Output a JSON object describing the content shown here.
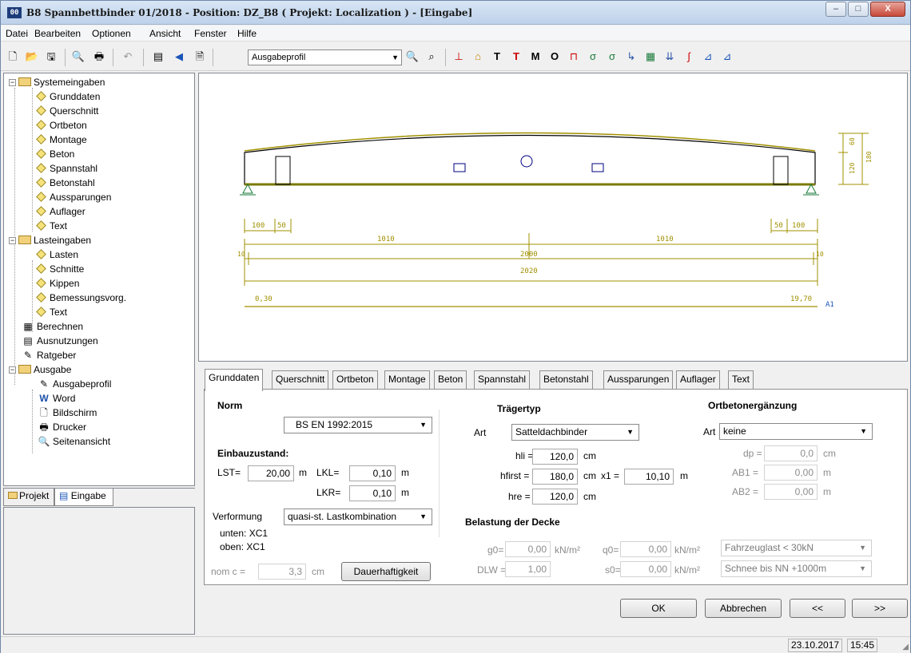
{
  "window": {
    "title": "B8 Spannbettbinder  01/2018 - Position: DZ_B8 ( Projekt: Localization ) - [Eingabe]",
    "icon_text": "00",
    "controls": {
      "minimize": "–",
      "maximize": "□",
      "close": "X"
    }
  },
  "menu": [
    "Datei",
    "Bearbeiten",
    "Optionen",
    "Ansicht",
    "Fenster",
    "Hilfe"
  ],
  "toolbar": {
    "profile_value": "Ausgabeprofil",
    "symbol_buttons": [
      "T",
      "T",
      "M",
      "O"
    ]
  },
  "tree": {
    "systemeingaben": "Systemeingaben",
    "system_items": [
      "Grunddaten",
      "Querschnitt",
      "Ortbeton",
      "Montage",
      "Beton",
      "Spannstahl",
      "Betonstahl",
      "Aussparungen",
      "Auflager",
      "Text"
    ],
    "lasteingaben": "Lasteingaben",
    "last_items": [
      "Lasten",
      "Schnitte",
      "Kippen",
      "Bemessungsvorg.",
      "Text"
    ],
    "berechnen": "Berechnen",
    "ausnutzungen": "Ausnutzungen",
    "ratgeber": "Ratgeber",
    "ausgabe": "Ausgabe",
    "ausgabe_items": [
      "Ausgabeprofil",
      "Word",
      "Bildschirm",
      "Drucker",
      "Seitenansicht"
    ]
  },
  "panel_tabs": {
    "projekt": "Projekt",
    "eingabe": "Eingabe"
  },
  "drawing": {
    "dim_left_100": "100",
    "dim_left_50": "50",
    "dim_right_50": "50",
    "dim_right_100": "100",
    "half_left": "1010",
    "half_right": "1010",
    "span_inner": "2000",
    "span_total": "2020",
    "end_left": "10",
    "end_right": "10",
    "axis_start": "0,30",
    "axis_end": "19,70",
    "axis_label": "A1",
    "height_upper": "60",
    "height_left": "120",
    "height_total": "180"
  },
  "tabs": [
    "Grunddaten",
    "Querschnitt",
    "Ortbeton",
    "Montage",
    "Beton",
    "Spannstahl",
    "Betonstahl",
    "Aussparungen",
    "Auflager",
    "Text"
  ],
  "form": {
    "norm_header": "Norm",
    "norm_value": "BS EN 1992:2015",
    "einbau_header": "Einbauzustand:",
    "lst_label": "LST=",
    "lst_value": "20,00",
    "lst_unit": "m",
    "lkl_label": "LKL=",
    "lkl_value": "0,10",
    "lkl_unit": "m",
    "lkr_label": "LKR=",
    "lkr_value": "0,10",
    "lkr_unit": "m",
    "verformung_label": "Verformung",
    "verformung_value": "quasi-st. Lastkombination",
    "unten": "unten: XC1",
    "oben": "oben: XC1",
    "nomc_label": "nom c =",
    "nomc_value": "3,3",
    "nomc_unit": "cm",
    "dauer_button": "Dauerhaftigkeit",
    "traeger_header": "Trägertyp",
    "art_label": "Art",
    "art_value": "Satteldachbinder",
    "hli_label": "hli =",
    "hli_value": "120,0",
    "hli_unit": "cm",
    "hfirst_label": "hfirst =",
    "hfirst_value": "180,0",
    "hfirst_unit": "cm",
    "x1_label": "x1 =",
    "x1_value": "10,10",
    "x1_unit": "m",
    "hre_label": "hre =",
    "hre_value": "120,0",
    "hre_unit": "cm",
    "ortbeton_header": "Ortbetonergänzung",
    "ort_art_label": "Art",
    "ort_art_value": "keine",
    "dp_label": "dp =",
    "dp_value": "0,0",
    "dp_unit": "cm",
    "ab1_label": "AB1 =",
    "ab1_value": "0,00",
    "ab1_unit": "m",
    "ab2_label": "AB2 =",
    "ab2_value": "0,00",
    "ab2_unit": "m",
    "belastung_header": "Belastung der Decke",
    "g0_label": "g0=",
    "g0_value": "0,00",
    "g0_unit": "kN/m²",
    "q0_label": "q0=",
    "q0_value": "0,00",
    "q0_unit": "kN/m²",
    "q0_select": "Fahrzeuglast < 30kN",
    "dlw_label": "DLW =",
    "dlw_value": "1,00",
    "s0_label": "s0=",
    "s0_value": "0,00",
    "s0_unit": "kN/m²",
    "s0_select": "Schnee bis NN +1000m"
  },
  "buttons": {
    "ok": "OK",
    "abbrechen": "Abbrechen",
    "prev": "<<",
    "next": ">>"
  },
  "status": {
    "date": "23.10.2017",
    "time": "15:45"
  }
}
